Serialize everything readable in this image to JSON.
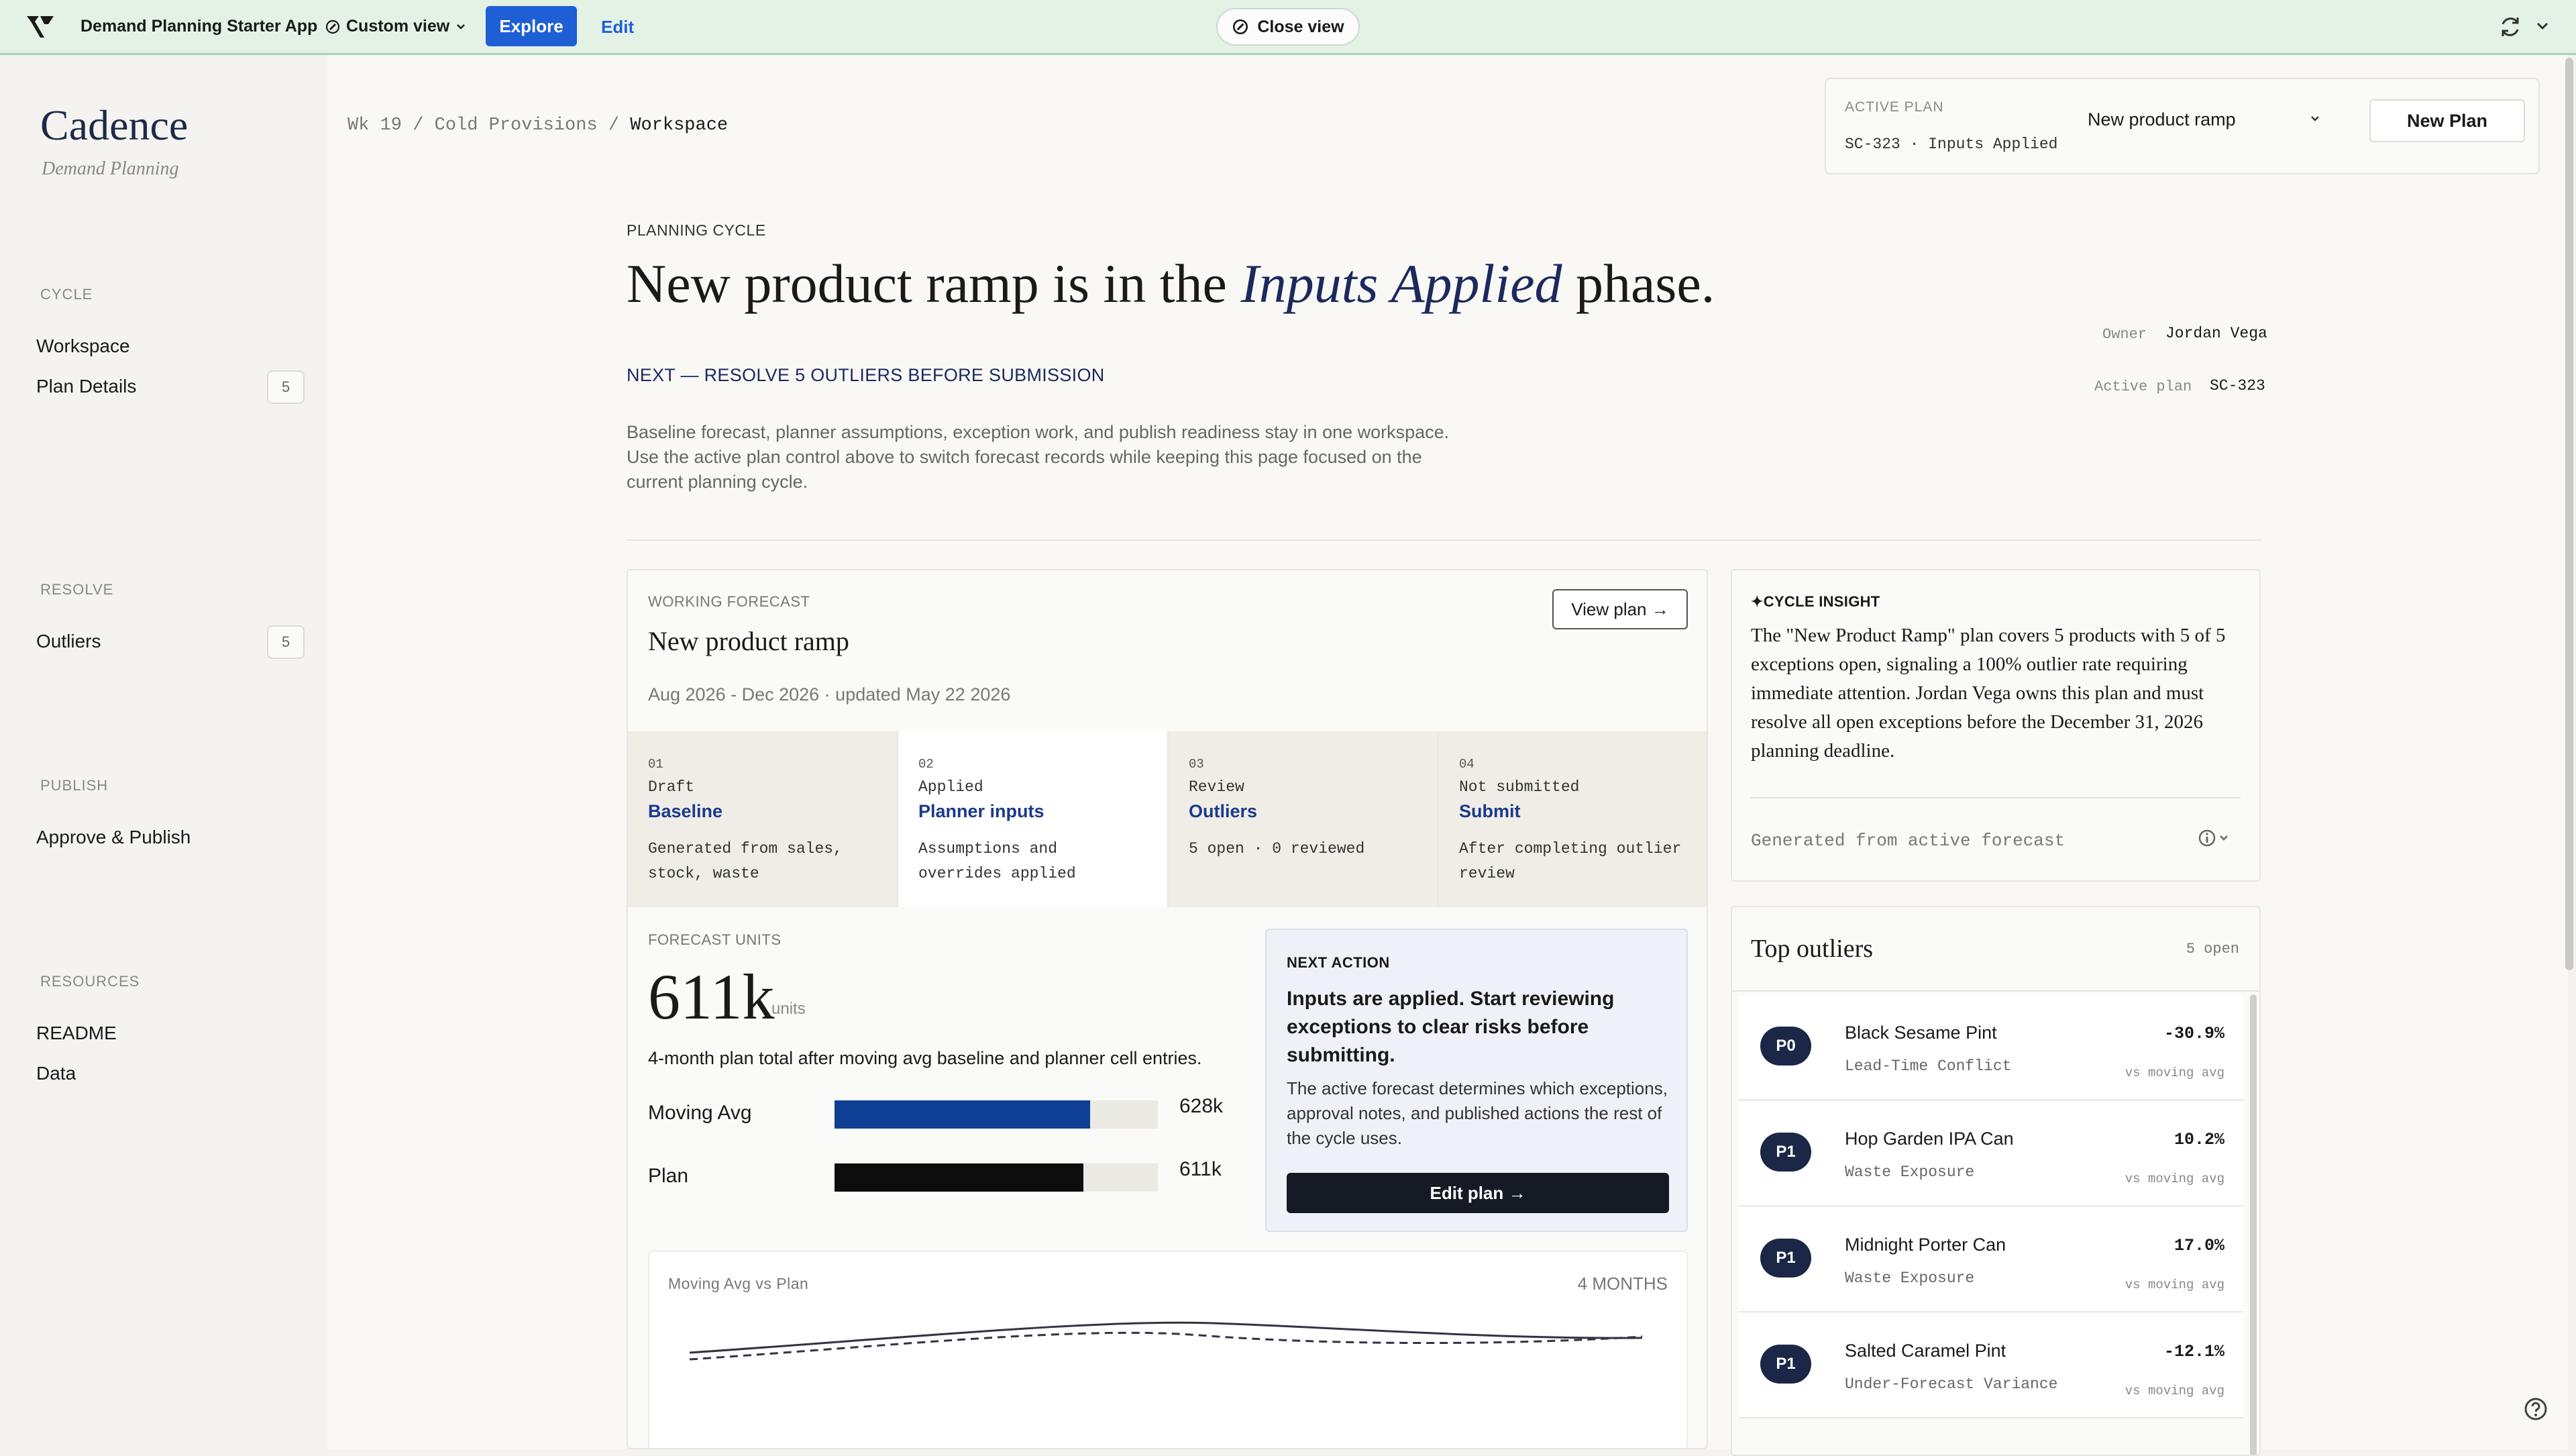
{
  "topbar": {
    "app_name": "Demand Planning Starter App",
    "custom_view": "Custom view",
    "explore": "Explore",
    "edit": "Edit",
    "close_view": "Close view"
  },
  "sidebar": {
    "brand": "Cadence",
    "brand_sub": "Demand Planning",
    "sections": {
      "cycle": "CYCLE",
      "resolve": "RESOLVE",
      "publish": "PUBLISH",
      "resources": "RESOURCES"
    },
    "items": {
      "workspace": "Workspace",
      "plan_details": "Plan Details",
      "plan_details_badge": "5",
      "outliers": "Outliers",
      "outliers_badge": "5",
      "approve_publish": "Approve & Publish",
      "readme": "README",
      "data": "Data"
    }
  },
  "breadcrumb": {
    "wk": "Wk 19",
    "sep": "/",
    "provisions": "Cold Provisions",
    "current": "Workspace"
  },
  "active_plan": {
    "label": "ACTIVE PLAN",
    "value": "SC-323 · Inputs Applied",
    "selected": "New product ramp",
    "new_plan": "New Plan"
  },
  "hero": {
    "eyebrow": "PLANNING CYCLE",
    "title_pre": "New product ramp is in the ",
    "title_em": "Inputs Applied",
    "title_post": " phase.",
    "next": "NEXT — RESOLVE 5 OUTLIERS BEFORE SUBMISSION",
    "description": "Baseline forecast, planner assumptions, exception work, and publish readiness stay in one workspace. Use the active plan control above to switch forecast records while keeping this page focused on the current planning cycle.",
    "owner_label": "Owner",
    "owner": "Jordan Vega",
    "active_plan_label": "Active plan",
    "active_plan": "SC-323"
  },
  "working_forecast": {
    "label": "WORKING FORECAST",
    "title": "New product ramp",
    "dates": "Aug 2026 - Dec 2026 · updated May 22 2026",
    "view_plan": "View plan →",
    "steps": [
      {
        "num": "01",
        "status": "Draft",
        "name": "Baseline",
        "desc": "Generated from sales, stock, waste"
      },
      {
        "num": "02",
        "status": "Applied",
        "name": "Planner inputs",
        "desc": "Assumptions and overrides applied"
      },
      {
        "num": "03",
        "status": "Review",
        "name": "Outliers",
        "desc": "5 open · 0 reviewed"
      },
      {
        "num": "04",
        "status": "Not submitted",
        "name": "Submit",
        "desc": "After completing outlier review"
      }
    ],
    "units_label": "FORECAST UNITS",
    "units_value": "611k",
    "units_unit": "units",
    "units_desc": "4-month plan total after moving avg baseline and planner cell entries.",
    "bars": [
      {
        "label": "Moving Avg",
        "value_text": "628k",
        "fraction": 0.79,
        "color": "#0f3f94"
      },
      {
        "label": "Plan",
        "value_text": "611k",
        "fraction": 0.77,
        "color": "#0d0d0d"
      }
    ]
  },
  "next_action": {
    "label": "NEXT ACTION",
    "headline": "Inputs are applied. Start reviewing exceptions to clear risks before submitting.",
    "body": "The active forecast determines which exceptions, approval notes, and published actions the rest of the cycle uses.",
    "button": "Edit plan →"
  },
  "mini_chart": {
    "title": "Moving Avg vs Plan",
    "range": "4 MONTHS"
  },
  "insight": {
    "label": "✦CYCLE INSIGHT",
    "text": "The \"New Product Ramp\" plan covers 5 products with 5 of 5 exceptions open, signaling a 100% outlier rate requiring immediate attention. Jordan Vega owns this plan and must resolve all open exceptions before the December 31, 2026 planning deadline.",
    "generated": "Generated from active forecast"
  },
  "top_outliers": {
    "title": "Top outliers",
    "count": "5 open",
    "rows": [
      {
        "priority": "P0",
        "name": "Black Sesame Pint",
        "reason": "Lead-Time Conflict",
        "pct": "-30.9%",
        "vs": "vs moving avg"
      },
      {
        "priority": "P1",
        "name": "Hop Garden IPA Can",
        "reason": "Waste Exposure",
        "pct": "10.2%",
        "vs": "vs moving avg"
      },
      {
        "priority": "P1",
        "name": "Midnight Porter Can",
        "reason": "Waste Exposure",
        "pct": "17.0%",
        "vs": "vs moving avg"
      },
      {
        "priority": "P1",
        "name": "Salted Caramel Pint",
        "reason": "Under-Forecast Variance",
        "pct": "-12.1%",
        "vs": "vs moving avg"
      }
    ]
  },
  "colors": {
    "accent": "#1f5fd6",
    "navy": "#1b2a5e",
    "bar_moving_avg": "#0f3f94",
    "bar_plan": "#0d0d0d"
  }
}
